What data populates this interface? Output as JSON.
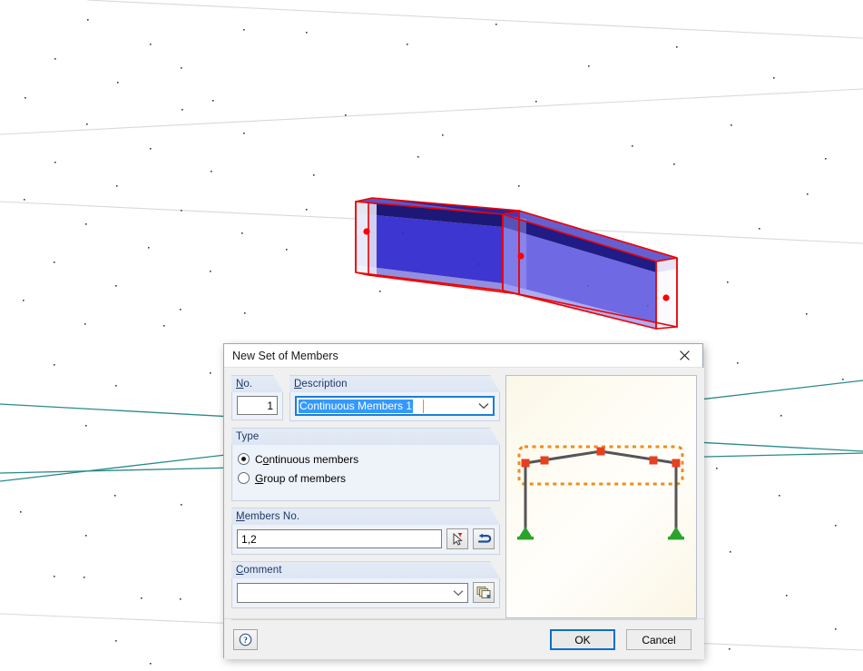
{
  "viewport": {
    "name": "3d-model-viewport",
    "background_color": "#ffffff",
    "grid_line_color": "#d8d8d8",
    "axis_line_color": "#2b8a8a",
    "model": {
      "name": "tapered-i-beam",
      "surface_color": "#3a34d2",
      "surface_color_light": "#5b55e0",
      "wireframe_color": "#ee0000",
      "node_color": "#ff0000",
      "node_count": 3
    }
  },
  "dialog": {
    "title": "New Set of Members",
    "close_icon": "close-icon",
    "no": {
      "label": "No.",
      "label_accesskey": "N",
      "value": "1"
    },
    "description": {
      "label": "Description",
      "label_accesskey": "D",
      "value": "Continuous Members 1",
      "dropdown_icon": "chevron-down-icon",
      "focused": true,
      "selected": true
    },
    "type": {
      "label": "Type",
      "options": [
        {
          "label": "Continuous members",
          "accesskey": "o",
          "selected": true
        },
        {
          "label": "Group of members",
          "accesskey": "G",
          "selected": false
        }
      ]
    },
    "members_no": {
      "label": "Members No.",
      "label_accesskey": "M",
      "value": "1,2",
      "pick_button_icon": "select-cursor-icon",
      "arrow_button_icon": "curved-arrow-icon"
    },
    "comment": {
      "label": "Comment",
      "label_accesskey": "C",
      "value": "",
      "dropdown_icon": "chevron-down-icon",
      "library_button_icon": "stacked-windows-icon"
    },
    "preview": {
      "name": "frame-preview",
      "background_color": "#fbf7e8",
      "member_color": "#555555",
      "node_color": "#e8401f",
      "support_color": "#2aa32a",
      "selection_color": "#f08c18"
    },
    "footer": {
      "help_icon": "help-question-icon",
      "ok_label": "OK",
      "cancel_label": "Cancel"
    }
  }
}
